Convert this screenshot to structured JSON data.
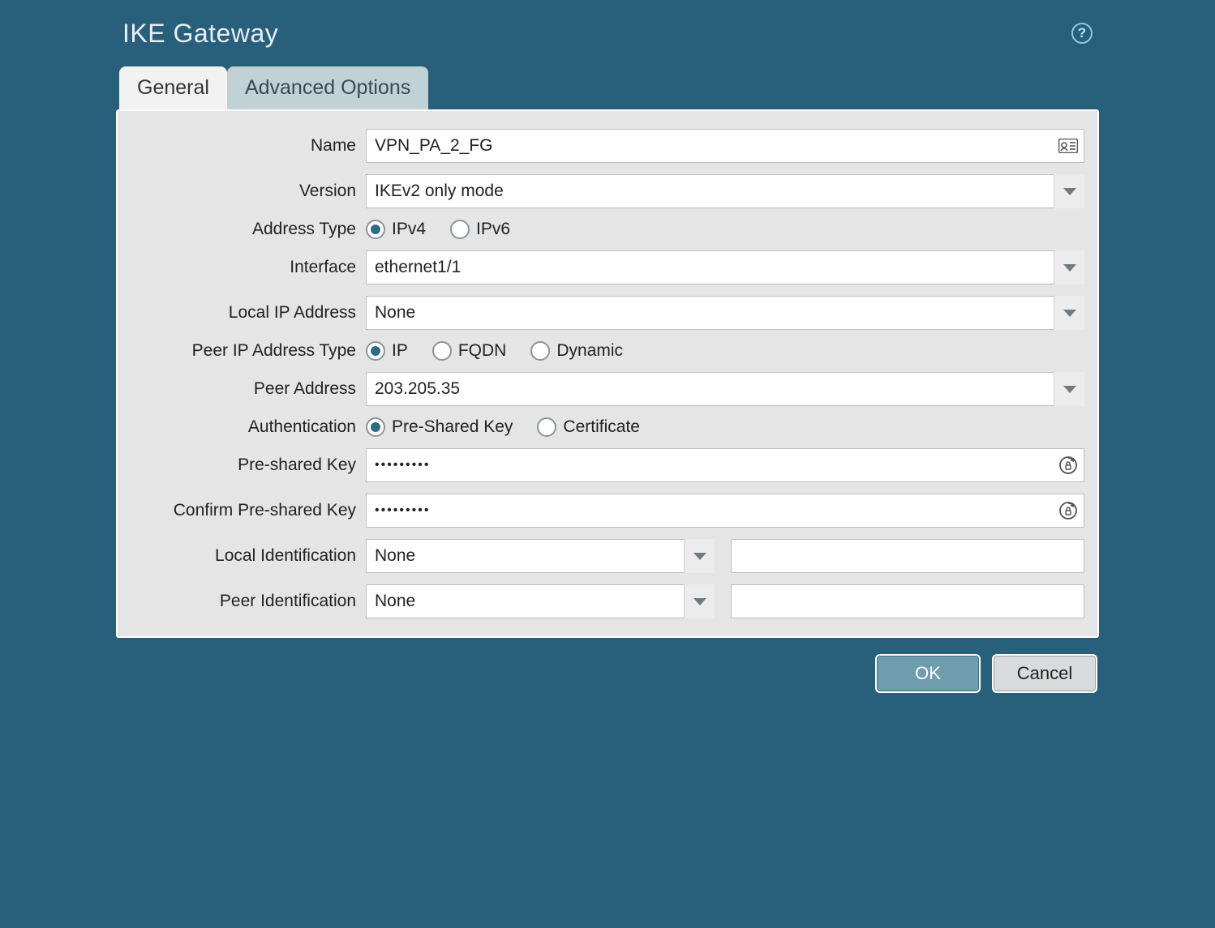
{
  "header": {
    "title": "IKE Gateway"
  },
  "tabs": {
    "general": "General",
    "advanced": "Advanced Options",
    "active": "general"
  },
  "labels": {
    "name": "Name",
    "version": "Version",
    "address_type": "Address Type",
    "interface": "Interface",
    "local_ip": "Local IP Address",
    "peer_ip_type": "Peer IP Address Type",
    "peer_address": "Peer Address",
    "authentication": "Authentication",
    "psk": "Pre-shared Key",
    "confirm_psk": "Confirm Pre-shared Key",
    "local_ident": "Local Identification",
    "peer_ident": "Peer Identification"
  },
  "fields": {
    "name": "VPN_PA_2_FG",
    "version": "IKEv2 only mode",
    "address_type": {
      "ipv4": "IPv4",
      "ipv6": "IPv6",
      "selected": "ipv4"
    },
    "interface": "ethernet1/1",
    "local_ip": "None",
    "peer_ip_type": {
      "ip": "IP",
      "fqdn": "FQDN",
      "dynamic": "Dynamic",
      "selected": "ip"
    },
    "peer_address": "203.205.35",
    "authentication": {
      "psk": "Pre-Shared Key",
      "cert": "Certificate",
      "selected": "psk"
    },
    "psk": "•••••••••",
    "confirm_psk": "•••••••••",
    "local_ident_type": "None",
    "local_ident_value": "",
    "peer_ident_type": "None",
    "peer_ident_value": ""
  },
  "buttons": {
    "ok": "OK",
    "cancel": "Cancel"
  }
}
